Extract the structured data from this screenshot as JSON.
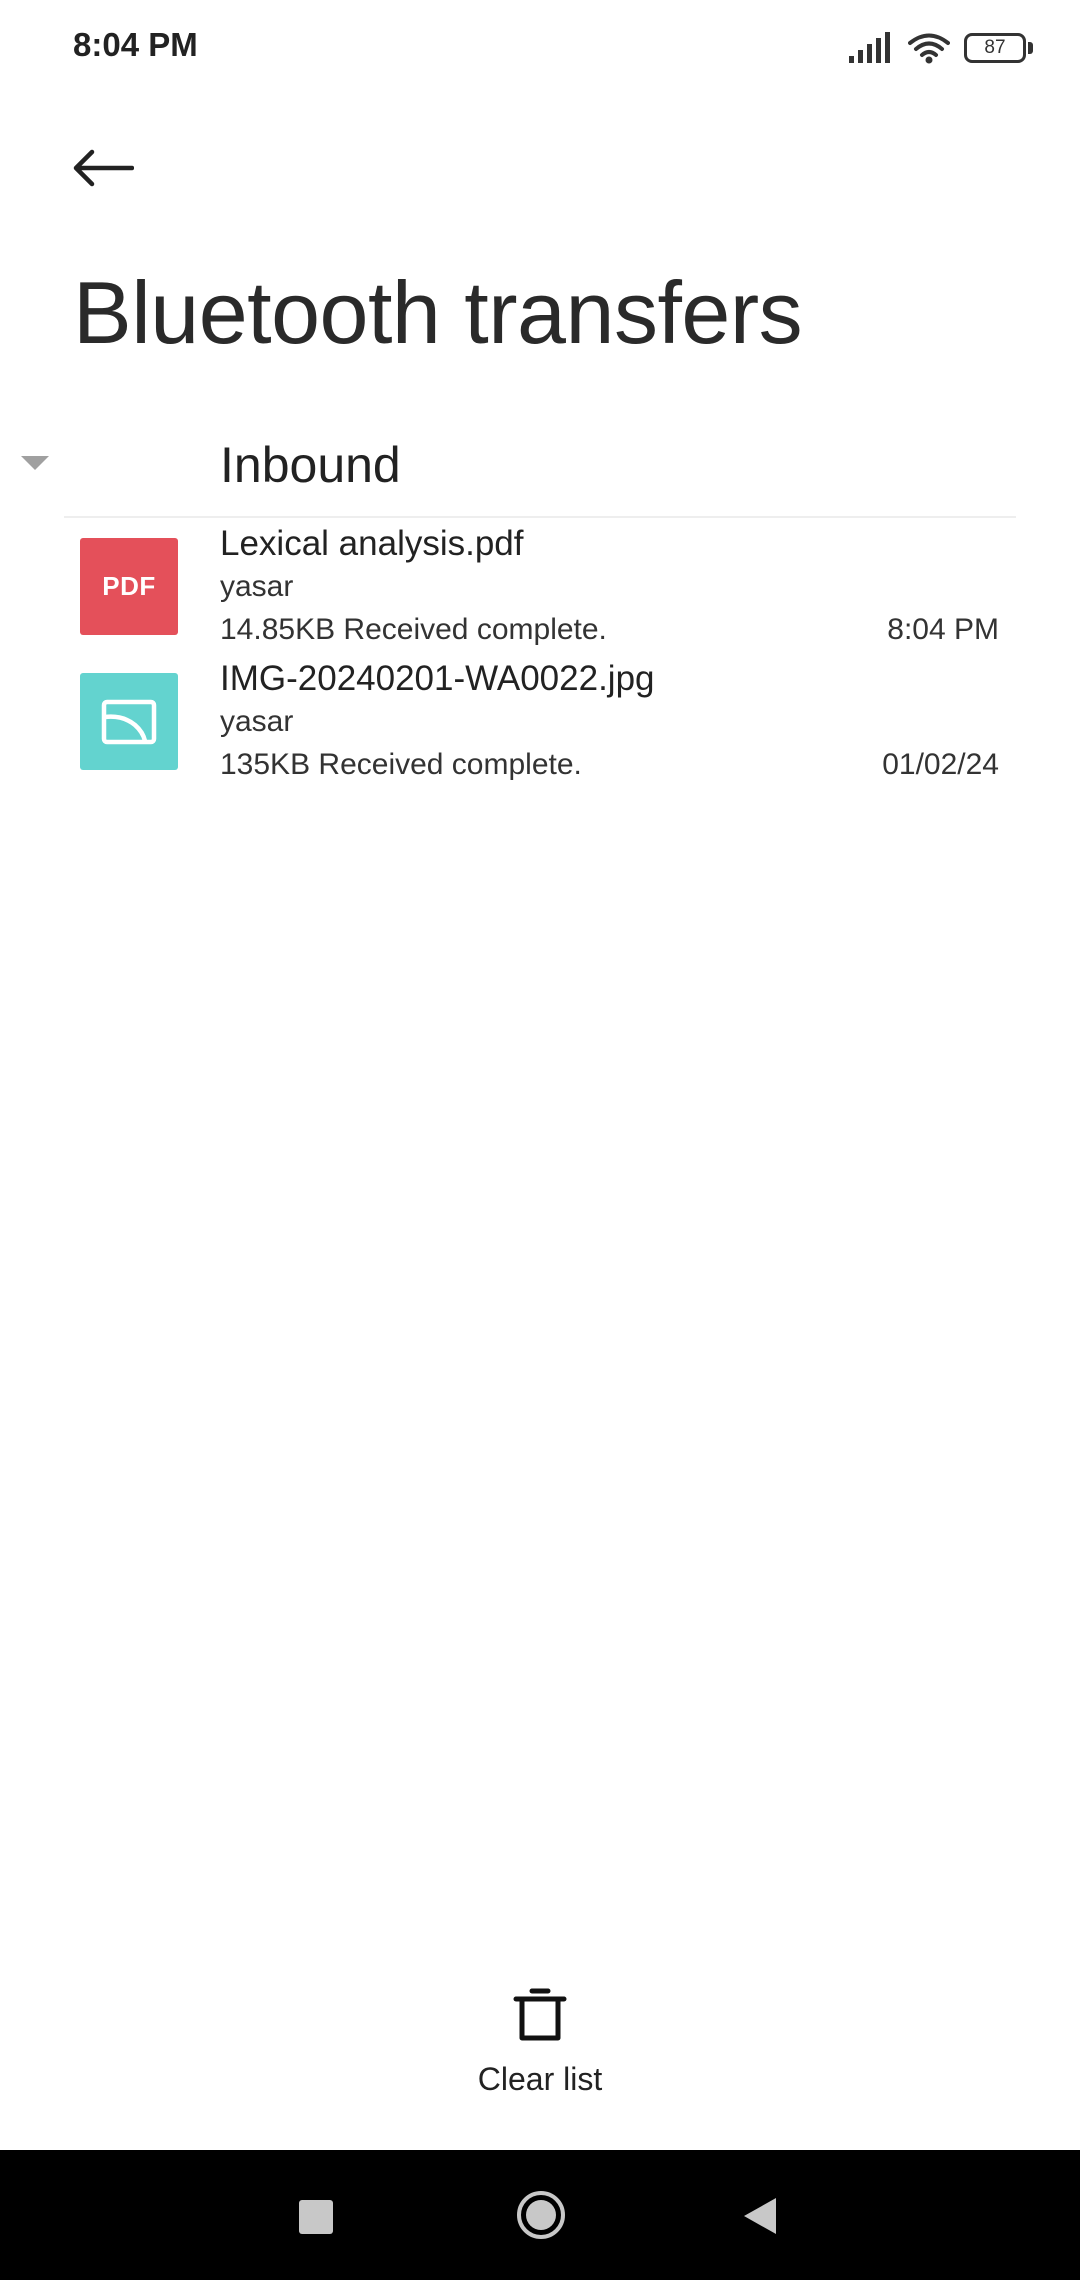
{
  "status_bar": {
    "time": "8:04 PM",
    "battery": "87",
    "icons": [
      "signal-icon",
      "wifi-icon",
      "battery-icon"
    ]
  },
  "header": {
    "back_icon": "arrow-left-icon",
    "title": "Bluetooth transfers"
  },
  "section": {
    "title": "Inbound",
    "toggle_icon": "caret-down-icon"
  },
  "transfers": [
    {
      "icon": "pdf-file-icon",
      "icon_label": "PDF",
      "icon_color": "#e4505a",
      "name": "Lexical analysis.pdf",
      "sender": "yasar",
      "status": "14.85KB Received complete.",
      "time": "8:04 PM"
    },
    {
      "icon": "image-file-icon",
      "icon_color": "#63d3cf",
      "name": "IMG-20240201-WA0022.jpg",
      "sender": "yasar",
      "status": "135KB Received complete.",
      "time": "01/02/24"
    }
  ],
  "footer": {
    "clear_icon": "trash-icon",
    "clear_label": "Clear list"
  },
  "nav_bar": {
    "icons": [
      "recents-square-icon",
      "home-circle-icon",
      "back-triangle-icon"
    ]
  }
}
